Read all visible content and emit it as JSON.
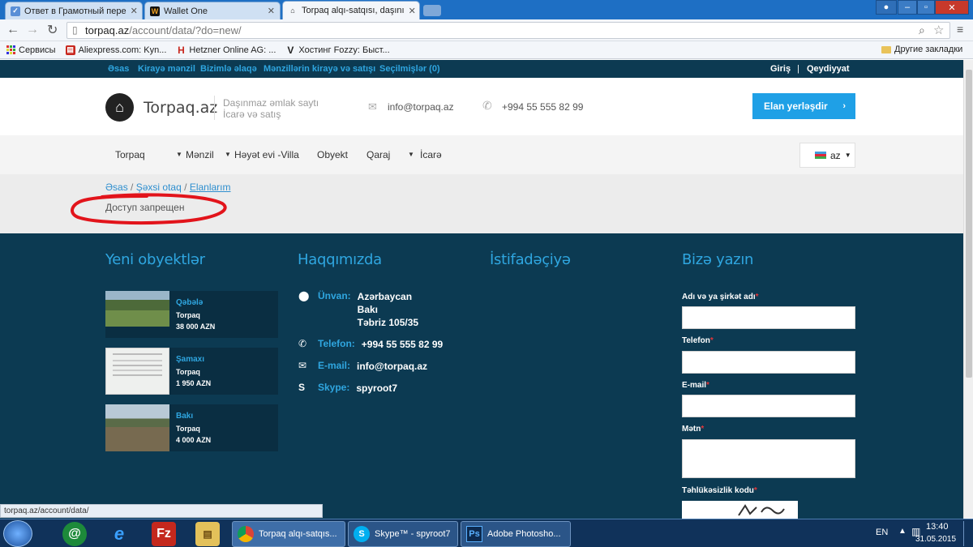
{
  "browser": {
    "tabs": [
      {
        "title": "Ответ в Грамотный пере",
        "icon": "mail-favicon"
      },
      {
        "title": "Wallet One",
        "icon": "w1-favicon"
      },
      {
        "title": "Torpaq alqı-satqısı, daşını",
        "icon": "home-favicon"
      }
    ],
    "url_host": "torpaq.az",
    "url_path": "/account/data/?do=new/",
    "bookmarks": [
      {
        "label": "Сервисы",
        "icon": "apps-icon"
      },
      {
        "label": "Aliexpress.com: Kyn...",
        "icon": "aliexpress-icon"
      },
      {
        "label": "Hetzner Online AG: ...",
        "icon": "hetzner-icon"
      },
      {
        "label": "Хостинг Fozzy: Быст...",
        "icon": "fozzy-icon"
      }
    ],
    "other_bookmarks": "Другие закладки",
    "status_url": "torpaq.az/account/data/"
  },
  "site": {
    "topnav": [
      "Əsas",
      "Kirayə mənzil",
      "Bizimlə əlaqə",
      "Mənzillərin kirayə və satışı",
      "Seçilmişlər (0)"
    ],
    "auth": {
      "login": "Giriş",
      "separator": "|",
      "register": "Qeydiyyat"
    },
    "logo_text": "Torpaq.az",
    "tagline_1": "Daşınmaz əmlak saytı",
    "tagline_2": "İcarə və satış",
    "email": "info@torpaq.az",
    "phone": "+994 55 555 82 99",
    "cta": "Elan yerləşdir",
    "menu": [
      {
        "label": "Torpaq",
        "caret": false
      },
      {
        "label": "Mənzil",
        "caret": true
      },
      {
        "label": "Həyət evi -Villa",
        "caret": true
      },
      {
        "label": "Obyekt",
        "caret": false
      },
      {
        "label": "Qaraj",
        "caret": false
      },
      {
        "label": "İcarə",
        "caret": true
      }
    ],
    "lang": "az",
    "breadcrumb": [
      "Əsas",
      "Şəxsi otaq",
      "Elanlarım"
    ],
    "breadcrumb_sep": "/",
    "access_message": "Доступ запрещен",
    "footer": {
      "col1_title": "Yeni obyektlər",
      "col2_title": "Haqqımızda",
      "col3_title": "İstifadəçiyə",
      "col4_title": "Bizə yazın",
      "objects": [
        {
          "city": "Qəbələ",
          "type": "Torpaq",
          "price": "38 000 AZN"
        },
        {
          "city": "Şamaxı",
          "type": "Torpaq",
          "price": "1 950 AZN"
        },
        {
          "city": "Bakı",
          "type": "Torpaq",
          "price": "4 000 AZN"
        }
      ],
      "contact": {
        "address_label": "Ünvan:",
        "address_lines": [
          "Azərbaycan",
          "Bakı",
          "Təbriz 105/35"
        ],
        "phone_label": "Telefon:",
        "phone": "+994 55 555 82 99",
        "email_label": "E-mail:",
        "email": "info@torpaq.az",
        "skype_label": "Skype:",
        "skype": "spyroot7"
      },
      "form": {
        "name_label": "Adı və ya şirkət adı",
        "phone_label": "Telefon",
        "email_label": "E-mail",
        "text_label": "Mətn",
        "captcha_label": "Təhlükəsizlik kodu",
        "required_mark": "*"
      }
    }
  },
  "taskbar": {
    "tasks": [
      "Torpaq alqı-satqıs...",
      "Skype™ - spyroot7",
      "Adobe Photosho..."
    ],
    "lang": "EN",
    "time": "13:40",
    "date": "31.05.2015"
  },
  "colors": {
    "accent": "#2fa6e0",
    "navy": "#0c3a52",
    "cta": "#1fa0e6",
    "annotation": "#e2141b"
  }
}
